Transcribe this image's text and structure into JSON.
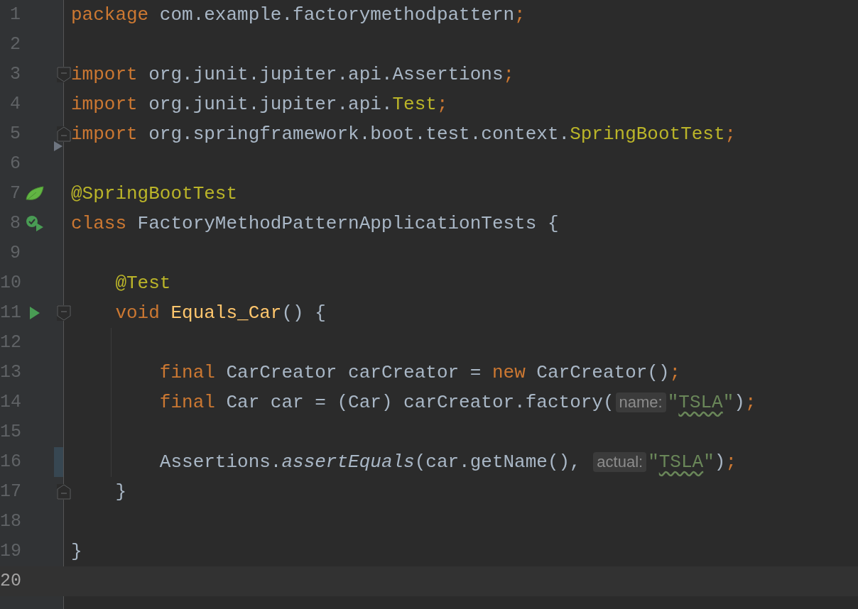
{
  "editor": {
    "lines": [
      {
        "number": "1",
        "tokens": [
          {
            "kind": "kw",
            "text": "package"
          },
          {
            "kind": "plain",
            "text": " com.example.factorymethodpattern"
          },
          {
            "kind": "kw",
            "text": ";"
          }
        ]
      },
      {
        "number": "2"
      },
      {
        "number": "3",
        "tokens": [
          {
            "kind": "kw",
            "text": "import"
          },
          {
            "kind": "plain",
            "text": " org.junit.jupiter.api.Assertions"
          },
          {
            "kind": "kw",
            "text": ";"
          }
        ]
      },
      {
        "number": "4",
        "tokens": [
          {
            "kind": "kw",
            "text": "import"
          },
          {
            "kind": "plain",
            "text": " org.junit.jupiter.api."
          },
          {
            "kind": "ann",
            "text": "Test"
          },
          {
            "kind": "kw",
            "text": ";"
          }
        ]
      },
      {
        "number": "5",
        "tokens": [
          {
            "kind": "kw",
            "text": "import"
          },
          {
            "kind": "plain",
            "text": " org.springframework.boot.test.context."
          },
          {
            "kind": "ann",
            "text": "SpringBootTest"
          },
          {
            "kind": "kw",
            "text": ";"
          }
        ]
      },
      {
        "number": "6"
      },
      {
        "number": "7",
        "tokens": [
          {
            "kind": "ann",
            "text": "@SpringBootTest"
          }
        ]
      },
      {
        "number": "8",
        "tokens": [
          {
            "kind": "kw",
            "text": "class"
          },
          {
            "kind": "plain",
            "text": " FactoryMethodPatternApplicationTests {"
          }
        ]
      },
      {
        "number": "9"
      },
      {
        "number": "10",
        "tokens": [
          {
            "kind": "ann",
            "text": "    @Test"
          }
        ]
      },
      {
        "number": "11",
        "tokens": [
          {
            "kind": "kw",
            "text": "    void "
          },
          {
            "kind": "method",
            "text": "Equals_Car"
          },
          {
            "kind": "plain",
            "text": "() {"
          }
        ]
      },
      {
        "number": "12",
        "guide": true
      },
      {
        "number": "13",
        "guide": true,
        "tokens": [
          {
            "kind": "kw",
            "text": "        final"
          },
          {
            "kind": "plain",
            "text": " CarCreator carCreator = "
          },
          {
            "kind": "kw",
            "text": "new"
          },
          {
            "kind": "plain",
            "text": " CarCreator()"
          },
          {
            "kind": "kw",
            "text": ";"
          }
        ]
      },
      {
        "number": "14",
        "guide": true,
        "tokens": [
          {
            "kind": "kw",
            "text": "        final"
          },
          {
            "kind": "plain",
            "text": " Car car = (Car) carCreator.factory("
          },
          {
            "kind": "hint",
            "text": "name:"
          },
          {
            "kind": "str",
            "text": "\""
          },
          {
            "kind": "str",
            "text": "TSLA",
            "typo": true
          },
          {
            "kind": "str",
            "text": "\""
          },
          {
            "kind": "plain",
            "text": ")"
          },
          {
            "kind": "kw",
            "text": ";"
          }
        ]
      },
      {
        "number": "15",
        "guide": true
      },
      {
        "number": "16",
        "guide": true,
        "changed": true,
        "tokens": [
          {
            "kind": "plain",
            "text": "        Assertions."
          },
          {
            "kind": "static",
            "text": "assertEquals"
          },
          {
            "kind": "plain",
            "text": "(car.getName(), "
          },
          {
            "kind": "hint",
            "text": "actual:"
          },
          {
            "kind": "str",
            "text": "\""
          },
          {
            "kind": "str",
            "text": "TSLA",
            "typo": true
          },
          {
            "kind": "str",
            "text": "\""
          },
          {
            "kind": "plain",
            "text": ")"
          },
          {
            "kind": "kw",
            "text": ";"
          }
        ]
      },
      {
        "number": "17",
        "tokens": [
          {
            "kind": "plain",
            "text": "    }"
          }
        ]
      },
      {
        "number": "18"
      },
      {
        "number": "19",
        "tokens": [
          {
            "kind": "plain",
            "text": "}"
          }
        ]
      },
      {
        "number": "20",
        "current": true
      }
    ]
  }
}
